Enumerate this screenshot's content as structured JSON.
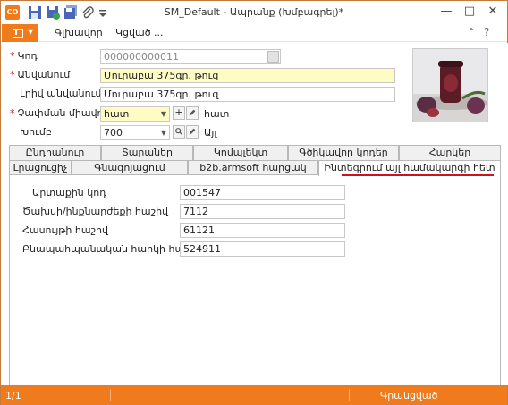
{
  "window": {
    "title": "SM_Default - Ապրանք (Խմբագրել)*",
    "app_icon_text": "CO",
    "minimize": "—",
    "maximize": "□",
    "close": "✕"
  },
  "ribbon": {
    "tabs": [
      "Գլխավոր",
      "Կցված ..."
    ],
    "collapse": "⌃",
    "help": "?"
  },
  "form": {
    "code": {
      "label": "Կոդ",
      "value": "000000000011"
    },
    "name": {
      "label": "Անվանում",
      "value": "Մուրաբա 375գր. թուզ"
    },
    "full_name": {
      "label": "Լրիվ անվանում",
      "value": "Մուրաբա 375գր. թուզ"
    },
    "unit": {
      "label": "Չափման միավոր",
      "value": "հատ",
      "display": "հատ",
      "add": "+"
    },
    "group": {
      "label": "Խումբ",
      "value": "700",
      "display": "Այլ"
    }
  },
  "tabs": {
    "row1": [
      "Ընդհանուր",
      "Տարաներ",
      "Կոմպլեկտ",
      "Գծիկավոր կոդեր",
      "Հարկեր"
    ],
    "row2": [
      "Լրացուցիչ",
      "Գնագոյացում",
      "b2b.armsoft հարցակ",
      "Ինտեգրում այլ համակարգի հետ"
    ]
  },
  "integration": {
    "external_code": {
      "label": "Արտաքին կոդ",
      "value": "001547"
    },
    "expense_account": {
      "label": "Ծախսի/ինքնարժեքի հաշիվ",
      "value": "7112"
    },
    "income_account": {
      "label": "Հասույթի հաշիվ",
      "value": "61121"
    },
    "natural_tax_account": {
      "label": "Բնապահպանական հարկի հաշիվ",
      "value": "524911"
    }
  },
  "status": {
    "record": "1/1",
    "state": "Գրանցված"
  },
  "colors": {
    "accent": "#f07b1c",
    "required": "#d22222",
    "highlight_field": "#fefbc3",
    "active_tab_underline": "#d0101e"
  }
}
